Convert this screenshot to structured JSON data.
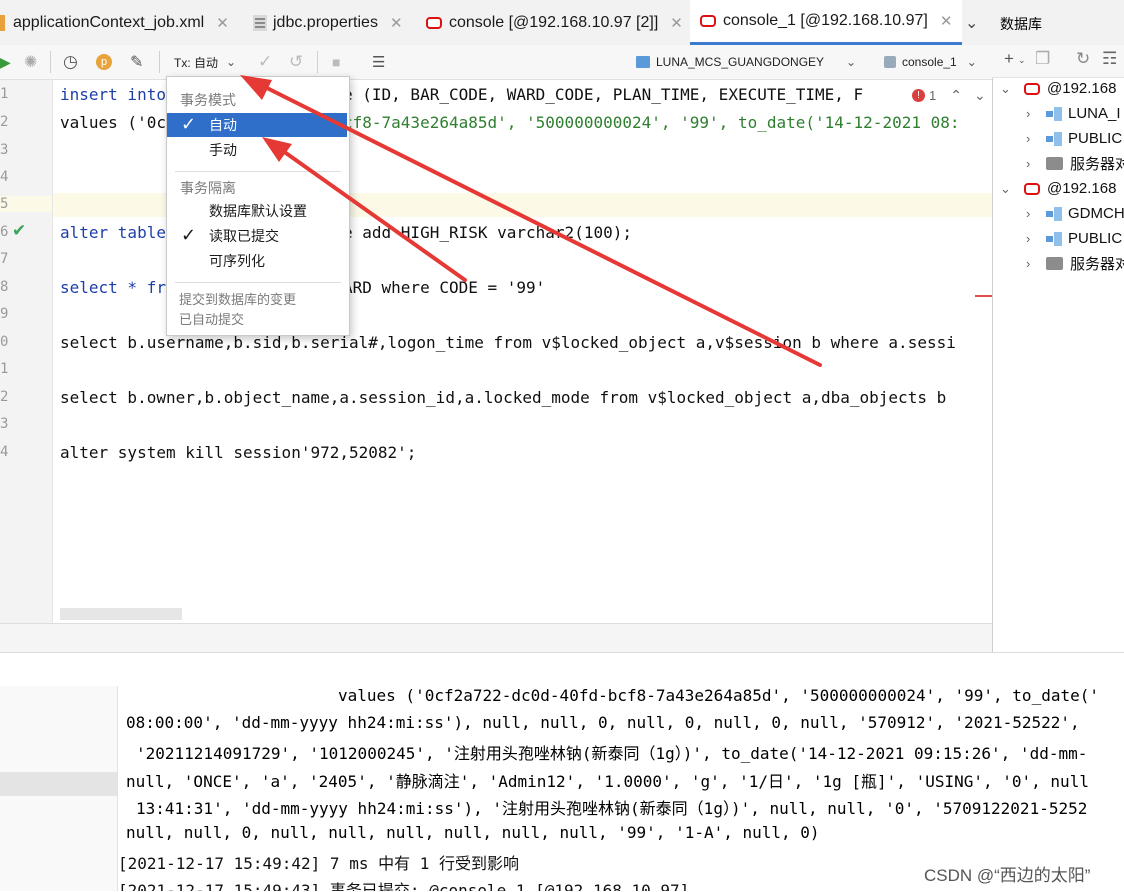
{
  "tabs": [
    {
      "label": "applicationContext_job.xml",
      "icon": "xml-file-icon"
    },
    {
      "label": "jdbc.properties",
      "icon": "properties-file-icon"
    },
    {
      "label": "console [@192.168.10.97 [2]]",
      "icon": "oracle-icon"
    },
    {
      "label": "console_1 [@192.168.10.97]",
      "icon": "oracle-icon",
      "active": true
    }
  ],
  "toolbar": {
    "tx_label": "Tx: 自动",
    "datasource": "LUNA_MCS_GUANGDONGEY",
    "session": "console_1"
  },
  "error_count": "1",
  "gutter_lines": [
    "1",
    "2",
    "3",
    "4",
    "5",
    "6",
    "7",
    "8",
    "9",
    "0",
    "1",
    "2",
    "3",
    "4"
  ],
  "editor": {
    "line1_a": "insert into",
    "line1_b": "e (ID, BAR_CODE, WARD_CODE, PLAN_TIME, EXECUTE_TIME, F",
    "line2_a": "values ('0c",
    "line2_b": "cf8-7a43e264a85d', '500000000024', '99', to_date('14-12-2021 08:",
    "line6_a": "alter table",
    "line6_b": "e add HIGH_RISK varchar2(100);",
    "line8_a": "select * fr",
    "line8_b": "ARD where CODE = '99'",
    "line10": "select b.username,b.sid,b.serial#,logon_time from v$locked_object a,v$session b where a.sessi",
    "line12": "select b.owner,b.object_name,a.session_id,a.locked_mode from v$locked_object a,dba_objects b",
    "line14": "alter system kill session'972,52082';"
  },
  "dropdown": {
    "header1": "事务模式",
    "auto": "自动",
    "manual": "手动",
    "header2": "事务隔离",
    "iso_default": "数据库默认设置",
    "iso_read_committed": "读取已提交",
    "iso_serializable": "可序列化",
    "footer1": "提交到数据库的变更",
    "footer2": "已自动提交"
  },
  "db_panel": {
    "title": "数据库",
    "conn1": "@192.168",
    "conn1_children": [
      "LUNA_I",
      "PUBLIC",
      "服务器对"
    ],
    "conn2": "@192.168",
    "conn2_children": [
      "GDMCH",
      "PUBLIC",
      "服务器对"
    ]
  },
  "output": {
    "l1": "values ('0cf2a722-dc0d-40fd-bcf8-7a43e264a85d', '500000000024', '99', to_date('",
    "l2": "08:00:00', 'dd-mm-yyyy hh24:mi:ss'), null, null, 0, null, 0, null, 0, null, '570912', '2021-52522',",
    "l3": "'20211214091729', '1012000245', '注射用头孢唑林钠(新泰同（1g）)', to_date('14-12-2021 09:15:26', 'dd-mm-",
    "l4": "null, 'ONCE', 'a', '2405', '静脉滴注', 'Admin12', '1.0000', 'g', '1/日', '1g [瓶]', 'USING', '0', null",
    "l5": "13:41:31', 'dd-mm-yyyy hh24:mi:ss'), '注射用头孢唑林钠(新泰同（1g）)', null, null, '0', '5709122021-5252",
    "l6": "null, null, 0, null, null, null, null, null, null, '99', '1-A', null, 0)",
    "l7": "[2021-12-17 15:49:42] 7 ms 中有 1 行受到影响",
    "l8": "[2021-12-17 15:49:43] 事务已提交: @console_1 [@192.168.10.97]"
  },
  "watermark": "CSDN @“西边的太阳”",
  "colors": {
    "accent": "#2f6fc9",
    "arrow": "#e53935",
    "oracle": "#d11111"
  }
}
